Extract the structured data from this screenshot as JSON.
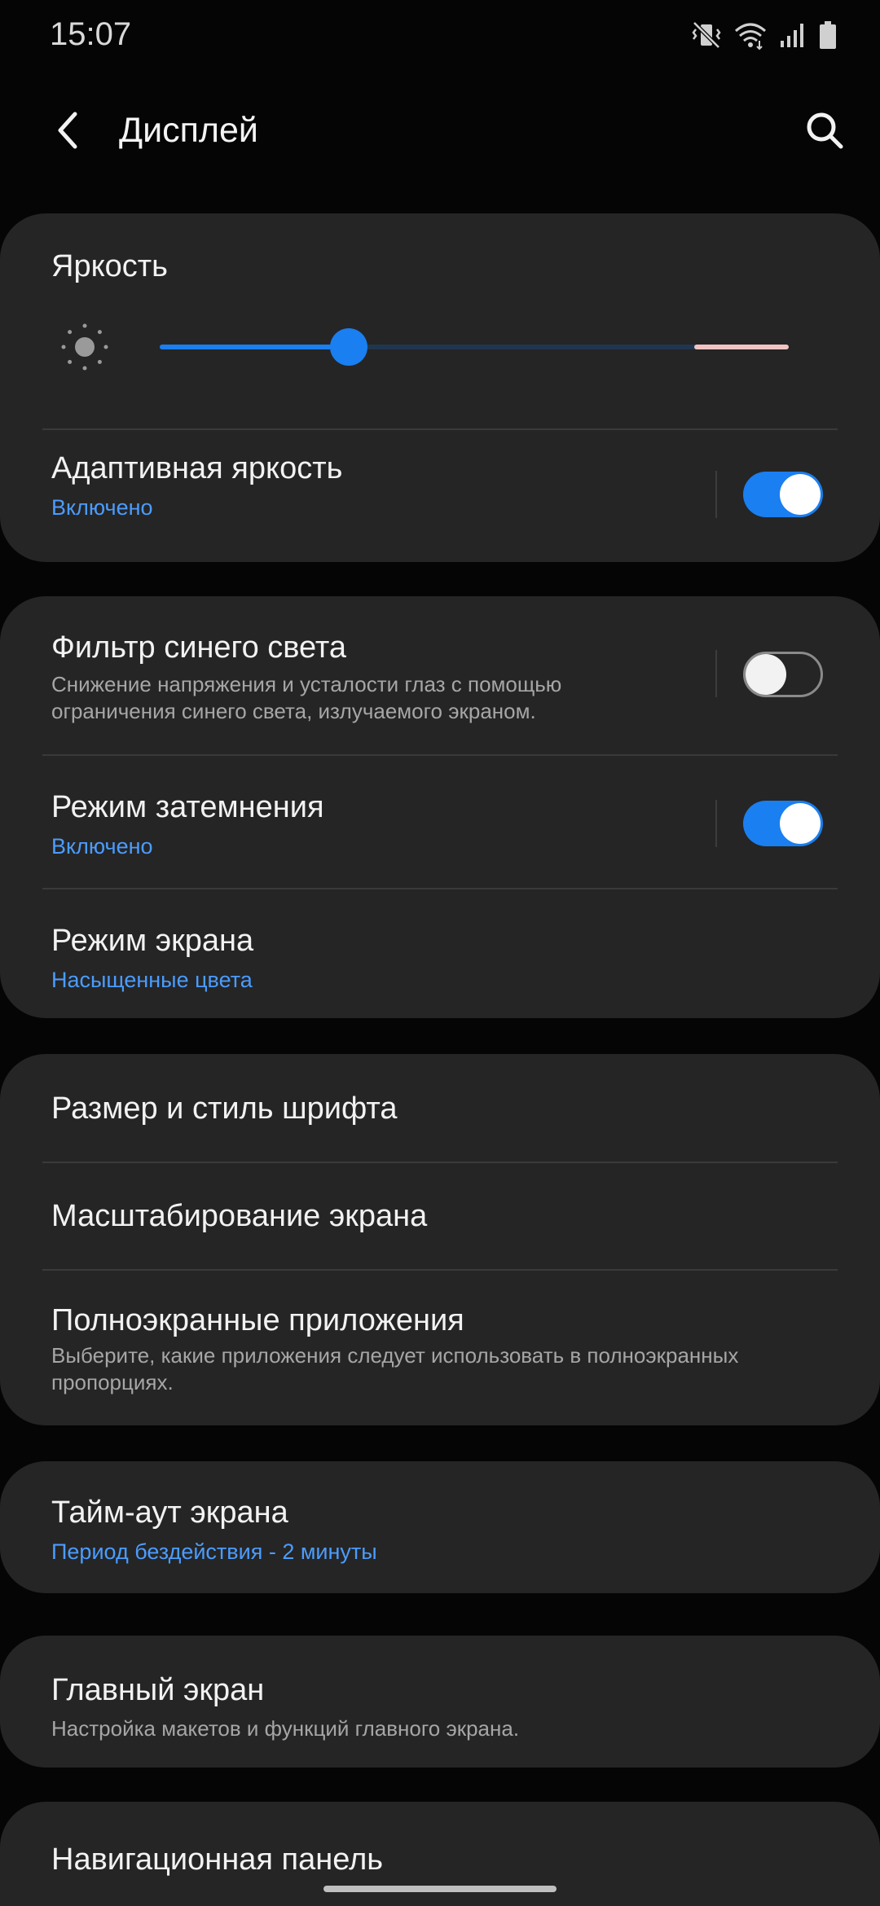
{
  "status_bar": {
    "time": "15:07",
    "icons": [
      "vibrate-mute-icon",
      "wifi-icon",
      "signal-icon",
      "battery-icon"
    ]
  },
  "app_bar": {
    "title": "Дисплей",
    "back_icon": "chevron-left-icon",
    "search_icon": "search-icon"
  },
  "brightness": {
    "title": "Яркость",
    "level": 0.3,
    "icon": "sun-icon"
  },
  "adaptive_brightness": {
    "title": "Адаптивная яркость",
    "subtitle": "Включено",
    "enabled": true
  },
  "blue_light": {
    "title": "Фильтр синего света",
    "description": "Снижение напряжения и усталости глаз с помощью ограничения синего света, излучаемого экраном.",
    "enabled": false
  },
  "dark_mode": {
    "title": "Режим затемнения",
    "subtitle": "Включено",
    "enabled": true
  },
  "screen_mode": {
    "title": "Режим экрана",
    "subtitle": "Насыщенные цвета"
  },
  "font_size": {
    "title": "Размер и стиль шрифта"
  },
  "screen_zoom": {
    "title": "Масштабирование экрана"
  },
  "fullscreen_apps": {
    "title": "Полноэкранные приложения",
    "description": "Выберите, какие приложения следует использовать в полноэкранных пропорциях."
  },
  "screen_timeout": {
    "title": "Тайм-аут экрана",
    "subtitle": "Период бездействия - 2 минуты"
  },
  "home_screen": {
    "title": "Главный экран",
    "description": "Настройка макетов и функций главного экрана."
  },
  "nav_bar": {
    "title": "Навигационная панель"
  },
  "colors": {
    "accent": "#1a7ff0",
    "subtitle": "#4b9cff",
    "card": "#252525",
    "background": "#050505"
  }
}
